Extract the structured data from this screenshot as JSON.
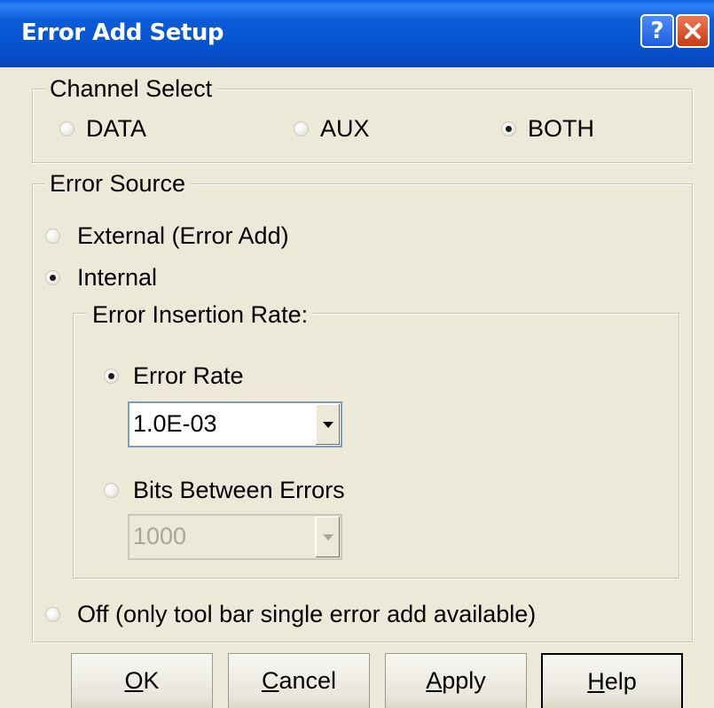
{
  "window": {
    "title": "Error Add Setup",
    "help_glyph": "?",
    "close_icon": "close-icon"
  },
  "channel_select": {
    "label": "Channel Select",
    "options": [
      {
        "label": "DATA",
        "checked": false
      },
      {
        "label": "AUX",
        "checked": false
      },
      {
        "label": "BOTH",
        "checked": true
      }
    ]
  },
  "error_source": {
    "label": "Error Source",
    "external_label": "External (Error Add)",
    "internal_label": "Internal",
    "off_label": "Off (only tool bar single error add available)",
    "selected": "Internal",
    "insertion_rate": {
      "label": "Error Insertion Rate:",
      "error_rate_label": "Error Rate",
      "error_rate_value": "1.0E-03",
      "bits_between_label": "Bits Between Errors",
      "bits_between_value": "1000",
      "selected": "Error Rate"
    }
  },
  "buttons": {
    "ok": {
      "mnemonic": "O",
      "rest": "K"
    },
    "cancel": {
      "mnemonic": "C",
      "rest": "ancel"
    },
    "apply": {
      "mnemonic": "A",
      "rest": "pply"
    },
    "help": {
      "mnemonic": "H",
      "rest": "elp"
    }
  },
  "colors": {
    "titlebar": "#0852CF",
    "face": "#ECE9D8",
    "close_button": "#C83B14"
  }
}
